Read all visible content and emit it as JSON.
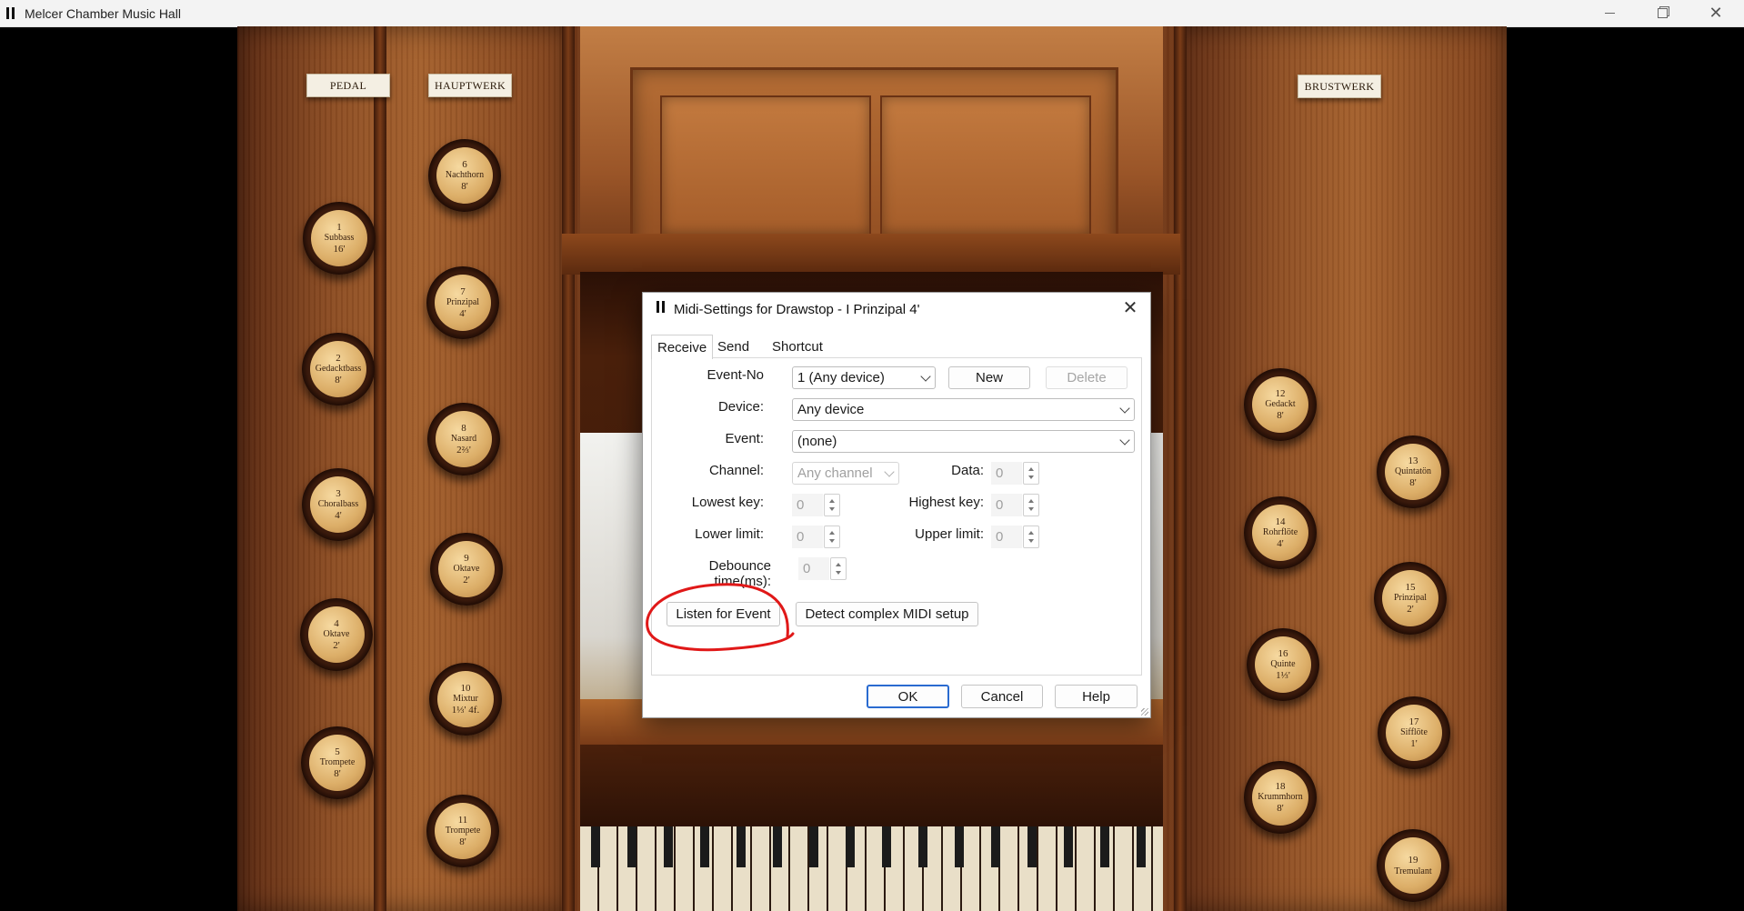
{
  "window": {
    "title": "Melcer Chamber Music Hall"
  },
  "organ": {
    "divisions": {
      "pedal": "PEDAL",
      "hauptwerk": "HAUPTWERK",
      "brustwerk": "BRUSTWERK"
    },
    "stops": [
      {
        "num": "1",
        "name": "Subbass",
        "foot": "16'"
      },
      {
        "num": "2",
        "name": "Gedacktbass",
        "foot": "8'"
      },
      {
        "num": "3",
        "name": "Choralbass",
        "foot": "4'"
      },
      {
        "num": "4",
        "name": "Oktave",
        "foot": "2'"
      },
      {
        "num": "5",
        "name": "Trompete",
        "foot": "8'"
      },
      {
        "num": "6",
        "name": "Nachthorn",
        "foot": "8'"
      },
      {
        "num": "7",
        "name": "Prinzipal",
        "foot": "4'"
      },
      {
        "num": "8",
        "name": "Nasard",
        "foot": "2⅔'"
      },
      {
        "num": "9",
        "name": "Oktave",
        "foot": "2'"
      },
      {
        "num": "10",
        "name": "Mixtur",
        "foot": "1⅓' 4f."
      },
      {
        "num": "11",
        "name": "Trompete",
        "foot": "8'"
      },
      {
        "num": "12",
        "name": "Gedackt",
        "foot": "8'"
      },
      {
        "num": "13",
        "name": "Quintatön",
        "foot": "8'"
      },
      {
        "num": "14",
        "name": "Rohrflöte",
        "foot": "4'"
      },
      {
        "num": "15",
        "name": "Prinzipal",
        "foot": "2'"
      },
      {
        "num": "16",
        "name": "Quinte",
        "foot": "1⅓'"
      },
      {
        "num": "17",
        "name": "Sifflöte",
        "foot": "1'"
      },
      {
        "num": "18",
        "name": "Krummhorn",
        "foot": "8'"
      },
      {
        "num": "19",
        "name": "Tremulant",
        "foot": ""
      }
    ]
  },
  "dialog": {
    "title": "Midi-Settings for Drawstop - I Prinzipal 4'",
    "tabs": [
      "Receive",
      "Send",
      "Shortcut"
    ],
    "active_tab": "Receive",
    "event_no_label": "Event-No",
    "event_no_value": "1 (Any device)",
    "new_button": "New",
    "delete_button": "Delete",
    "device_label": "Device:",
    "device_value": "Any device",
    "event_label": "Event:",
    "event_value": "(none)",
    "channel_label": "Channel:",
    "channel_value": "Any channel",
    "data_label": "Data:",
    "data_value": "0",
    "lowest_key_label": "Lowest key:",
    "lowest_key_value": "0",
    "highest_key_label": "Highest key:",
    "highest_key_value": "0",
    "lower_limit_label": "Lower limit:",
    "lower_limit_value": "0",
    "upper_limit_label": "Upper limit:",
    "upper_limit_value": "0",
    "debounce_label": "Debounce time(ms):",
    "debounce_value": "0",
    "listen_button": "Listen for Event",
    "detect_button": "Detect complex MIDI setup",
    "ok_button": "OK",
    "cancel_button": "Cancel",
    "help_button": "Help"
  },
  "colors": {
    "annotation_red": "#e01818",
    "ok_focus_blue": "#2a6bd0"
  }
}
